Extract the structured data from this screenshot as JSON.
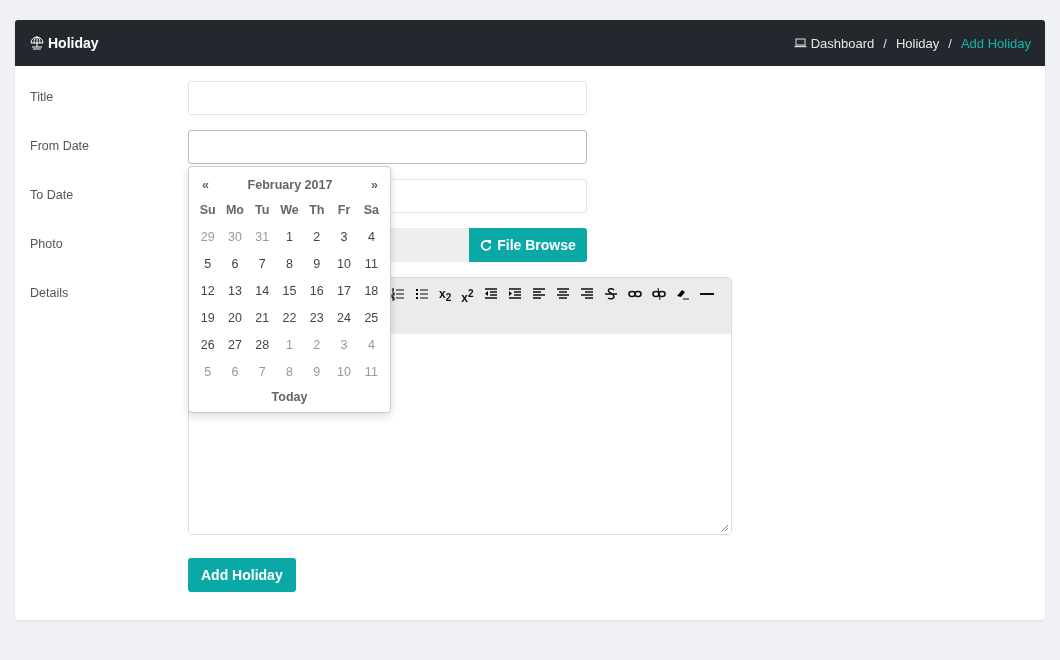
{
  "header": {
    "title": "Holiday",
    "separator": "/",
    "breadcrumb": [
      {
        "kind": "with-icon",
        "label": "Dashboard",
        "active": false
      },
      {
        "kind": "plain",
        "label": "Holiday",
        "active": false
      },
      {
        "kind": "plain",
        "label": "Add Holiday",
        "active": true
      }
    ]
  },
  "form": {
    "fields": [
      {
        "kind": "text",
        "label": "Title"
      },
      {
        "kind": "date",
        "label": "From Date"
      },
      {
        "kind": "text",
        "label": "To Date"
      },
      {
        "kind": "file",
        "label": "Photo",
        "button": "File Browse"
      },
      {
        "kind": "editor",
        "label": "Details"
      }
    ],
    "submit": "Add Holiday"
  },
  "editor": {
    "tools": [
      {
        "kind": "ordered-list"
      },
      {
        "kind": "bullet-list"
      },
      {
        "kind": "text",
        "label": "x$_{2}$"
      },
      {
        "kind": "text",
        "label": "x$^{2}$"
      },
      {
        "kind": "outdent"
      },
      {
        "kind": "indent"
      },
      {
        "kind": "align-left"
      },
      {
        "kind": "align-center"
      },
      {
        "kind": "align-right"
      },
      {
        "kind": "strike"
      },
      {
        "kind": "link"
      },
      {
        "kind": "unlink"
      },
      {
        "kind": "eraser"
      },
      {
        "kind": "rule"
      }
    ]
  },
  "calendar": {
    "prev": "«",
    "title": "February 2017",
    "next": "»",
    "weekdays": [
      "Su",
      "Mo",
      "Tu",
      "We",
      "Th",
      "Fr",
      "Sa"
    ],
    "weeks": [
      [
        {
          "day": "29",
          "muted": true
        },
        {
          "day": "30",
          "muted": true
        },
        {
          "day": "31",
          "muted": true
        },
        {
          "day": "1",
          "muted": false
        },
        {
          "day": "2",
          "muted": false
        },
        {
          "day": "3",
          "muted": false
        },
        {
          "day": "4",
          "muted": false
        }
      ],
      [
        {
          "day": "5",
          "muted": false
        },
        {
          "day": "6",
          "muted": false
        },
        {
          "day": "7",
          "muted": false
        },
        {
          "day": "8",
          "muted": false
        },
        {
          "day": "9",
          "muted": false
        },
        {
          "day": "10",
          "muted": false
        },
        {
          "day": "11",
          "muted": false
        }
      ],
      [
        {
          "day": "12",
          "muted": false
        },
        {
          "day": "13",
          "muted": false
        },
        {
          "day": "14",
          "muted": false
        },
        {
          "day": "15",
          "muted": false
        },
        {
          "day": "16",
          "muted": false
        },
        {
          "day": "17",
          "muted": false
        },
        {
          "day": "18",
          "muted": false
        }
      ],
      [
        {
          "day": "19",
          "muted": false
        },
        {
          "day": "20",
          "muted": false
        },
        {
          "day": "21",
          "muted": false
        },
        {
          "day": "22",
          "muted": false
        },
        {
          "day": "23",
          "muted": false
        },
        {
          "day": "24",
          "muted": false
        },
        {
          "day": "25",
          "muted": false
        }
      ],
      [
        {
          "day": "26",
          "muted": false
        },
        {
          "day": "27",
          "muted": false
        },
        {
          "day": "28",
          "muted": false
        },
        {
          "day": "1",
          "muted": true
        },
        {
          "day": "2",
          "muted": true
        },
        {
          "day": "3",
          "muted": true
        },
        {
          "day": "4",
          "muted": true
        }
      ],
      [
        {
          "day": "5",
          "muted": true
        },
        {
          "day": "6",
          "muted": true
        },
        {
          "day": "7",
          "muted": true
        },
        {
          "day": "8",
          "muted": true
        },
        {
          "day": "9",
          "muted": true
        },
        {
          "day": "10",
          "muted": true
        },
        {
          "day": "11",
          "muted": true
        }
      ]
    ],
    "footer": "Today"
  }
}
